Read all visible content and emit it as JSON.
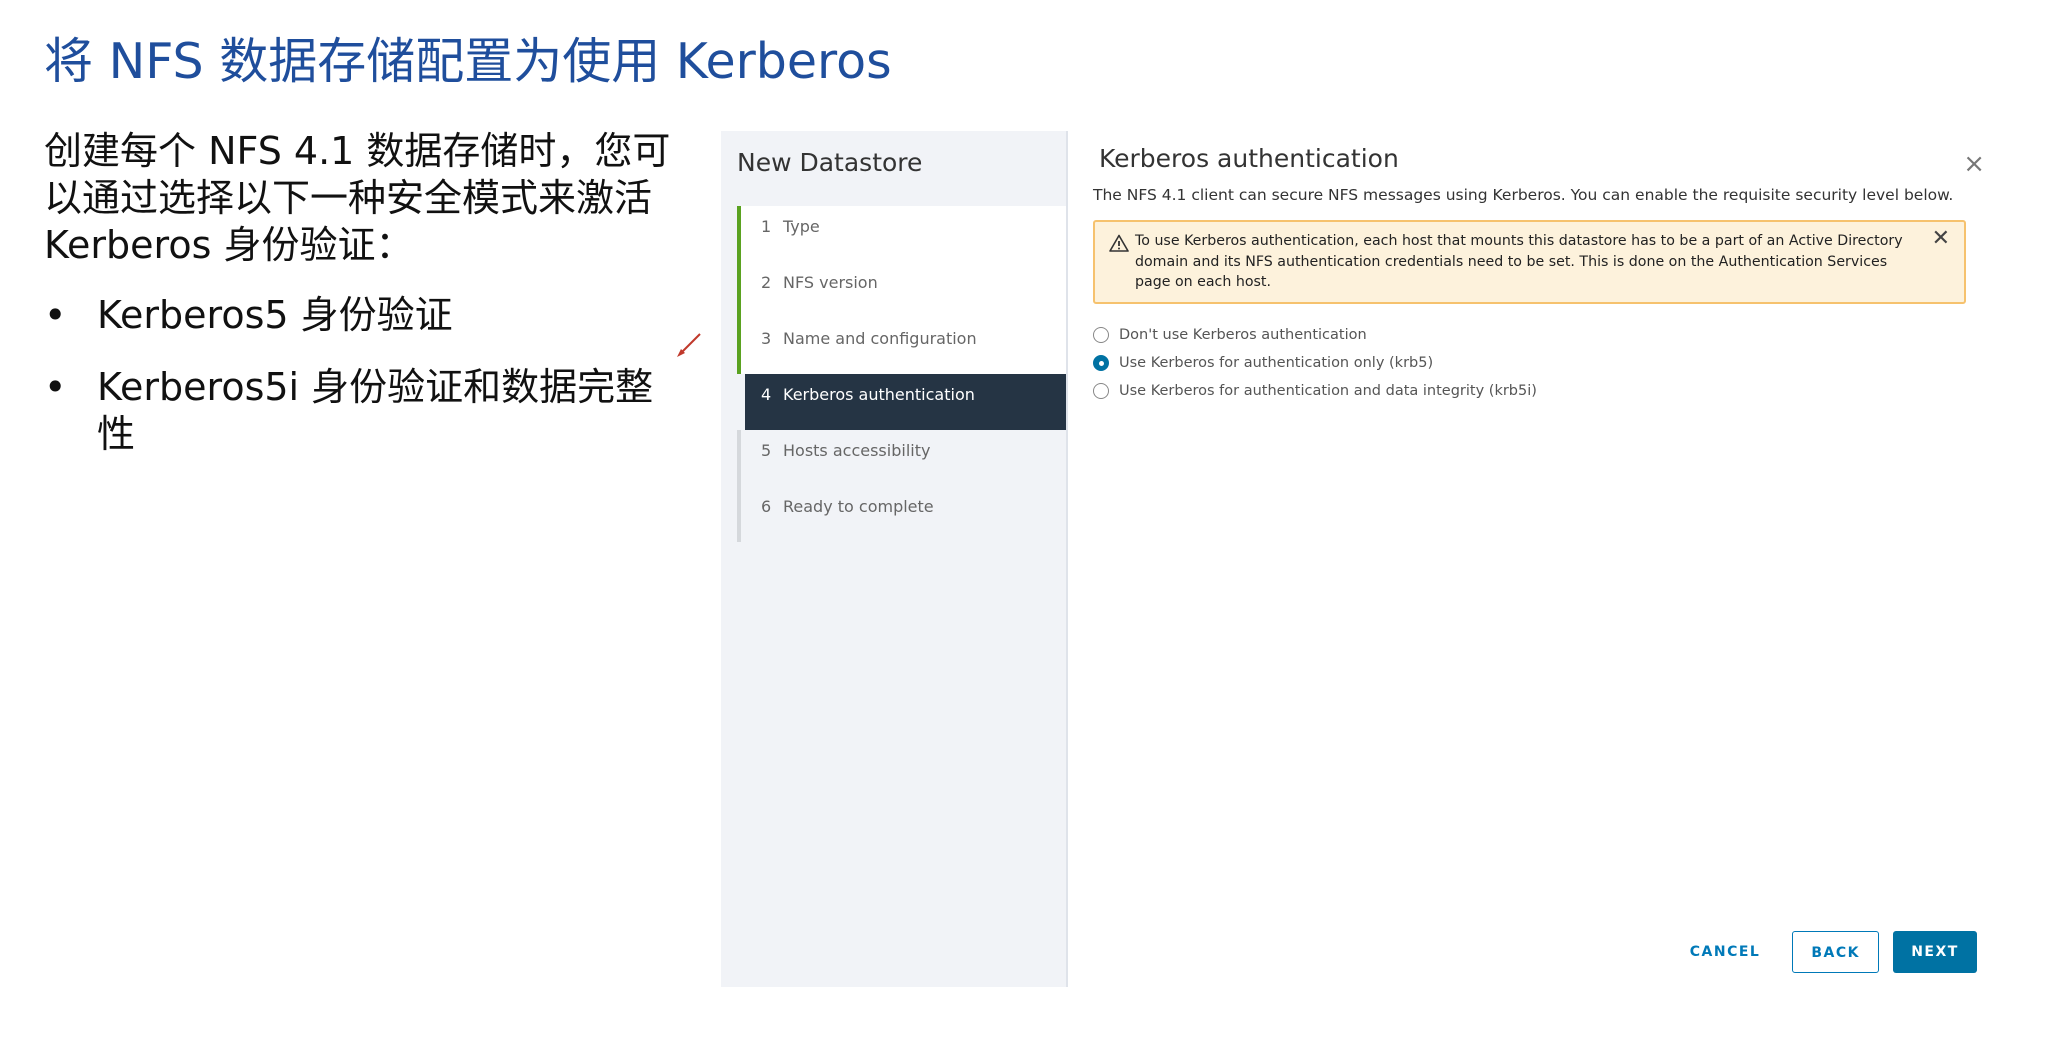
{
  "slide": {
    "title": "将 NFS 数据存储配置为使用 Kerberos",
    "intro": "创建每个 NFS 4.1 数据存储时，您可以通过选择以下一种安全模式来激活 Kerberos 身份验证：",
    "bullet_symbol": "•",
    "bullets": [
      "Kerberos5 身份验证",
      "Kerberos5i 身份验证和数据完整性"
    ]
  },
  "wizard": {
    "title": "New Datastore",
    "steps": [
      {
        "num": "1",
        "label": "Type"
      },
      {
        "num": "2",
        "label": "NFS version"
      },
      {
        "num": "3",
        "label": "Name and configuration"
      },
      {
        "num": "4",
        "label": "Kerberos authentication"
      },
      {
        "num": "5",
        "label": "Hosts accessibility"
      },
      {
        "num": "6",
        "label": "Ready to complete"
      }
    ],
    "active_step": 4,
    "page_heading": "Kerberos authentication",
    "close_glyph": "×",
    "description": "The NFS 4.1 client can secure NFS messages using Kerberos. You can enable the requisite security level below.",
    "alert": {
      "text": "To use Kerberos authentication, each host that mounts this datastore has to be a part of an Active Directory domain and its NFS authentication credentials need to be set. This is done on the Authentication Services page on each host.",
      "close_glyph": "✕"
    },
    "options": [
      {
        "label": "Don't use Kerberos authentication",
        "checked": false
      },
      {
        "label": "Use Kerberos for authentication only (krb5)",
        "checked": true
      },
      {
        "label": "Use Kerberos for authentication and data integrity (krb5i)",
        "checked": false
      }
    ],
    "buttons": {
      "cancel": "CANCEL",
      "back": "BACK",
      "next": "NEXT"
    }
  },
  "colors": {
    "title": "#1f4e9c",
    "active_step_bg": "#253444",
    "completed_bar": "#5aa220",
    "primary": "#0072a3",
    "alert_bg": "#fdf2dc",
    "alert_border": "#f6c26e"
  },
  "icons": {
    "alert": "warning-triangle-icon",
    "annotation": "pen-icon"
  }
}
